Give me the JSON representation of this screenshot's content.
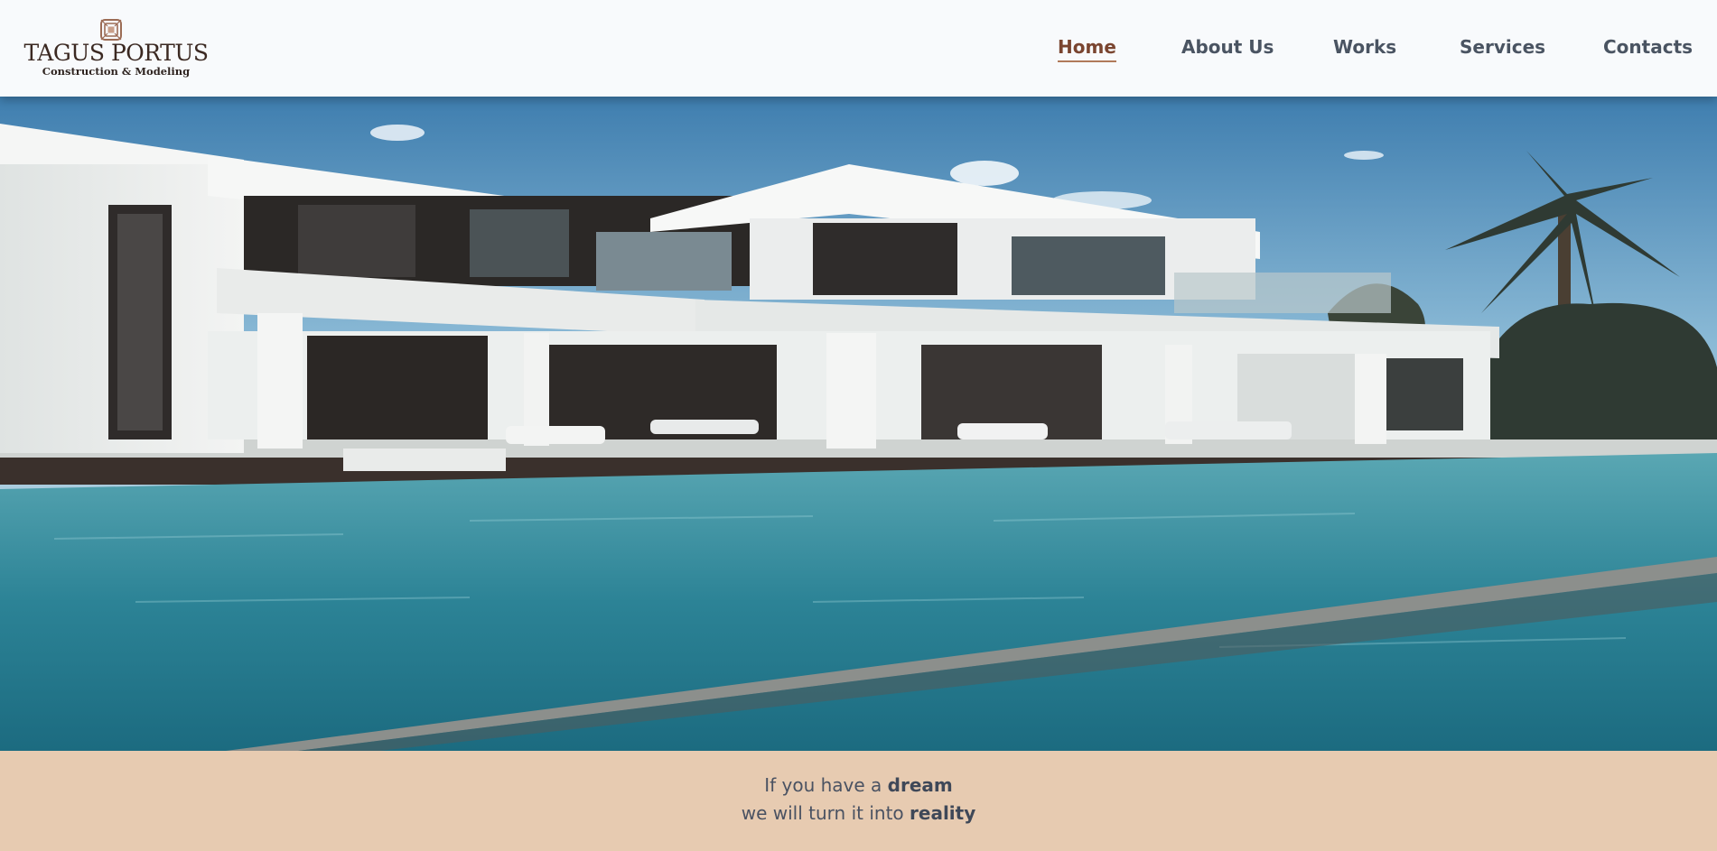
{
  "brand": {
    "name": "TAGUS PORTUS",
    "subtitle": "Construction & Modeling",
    "logo_icon": "diamond-frame-logo-icon",
    "colors": {
      "dark_brown": "#3b2922",
      "copper": "#a0705a"
    }
  },
  "nav": {
    "items": [
      {
        "label": "Home",
        "active": true
      },
      {
        "label": "About Us",
        "active": false
      },
      {
        "label": "Works",
        "active": false
      },
      {
        "label": "Services",
        "active": false
      },
      {
        "label": "Contacts",
        "active": false
      }
    ],
    "active_color": "#7a4530",
    "text_color": "#4a5462"
  },
  "hero": {
    "image_subject": "modern-white-villa-with-pool",
    "colors": {
      "sky": "#6fa3c9",
      "pool": "#2f8a9a",
      "walls": "#eef0ef"
    }
  },
  "tagline": {
    "line1_prefix": "If you have a",
    "line1_emphasis": "dream",
    "line2_prefix": "we will turn it into",
    "line2_emphasis": "reality",
    "band_color": "#e7cbb1"
  }
}
